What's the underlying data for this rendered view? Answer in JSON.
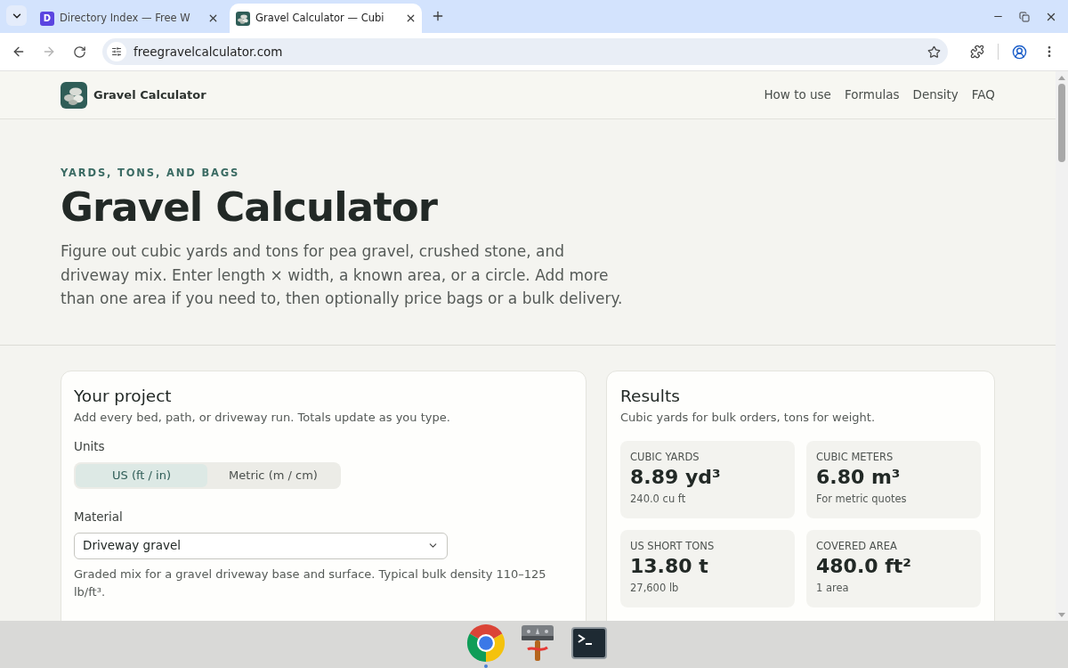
{
  "browser": {
    "tabs": [
      {
        "title": "Directory Index — Free W",
        "favicon": {
          "kind": "letter",
          "text": "D"
        },
        "selected": false
      },
      {
        "title": "Gravel Calculator — Cubi",
        "favicon": {
          "kind": "site-logo"
        },
        "selected": true
      }
    ],
    "forward_disabled": true,
    "url": "freegravelcalculator.com"
  },
  "site_header": {
    "brand": "Gravel Calculator",
    "nav": [
      "How to use",
      "Formulas",
      "Density",
      "FAQ"
    ]
  },
  "hero": {
    "eyebrow": "YARDS, TONS, AND BAGS",
    "title": "Gravel Calculator",
    "intro": "Figure out cubic yards and tons for pea gravel, crushed stone, and driveway mix. Enter length × width, a known area, or a circle. Add more than one area if you need to, then optionally price bags or a bulk delivery."
  },
  "project": {
    "title": "Your project",
    "subtitle": "Add every bed, path, or driveway run. Totals update as you type.",
    "units": {
      "label": "Units",
      "options": [
        {
          "label": "US (ft / in)",
          "selected": true
        },
        {
          "label": "Metric (m / cm)",
          "selected": false
        }
      ]
    },
    "material": {
      "label": "Material",
      "value": "Driveway gravel",
      "hint": "Graded mix for a gravel driveway base and surface. Typical bulk density 110–125 lb/ft³."
    }
  },
  "results": {
    "title": "Results",
    "subtitle": "Cubic yards for bulk orders, tons for weight.",
    "stats": [
      {
        "label": "CUBIC YARDS",
        "value": "8.89 yd³",
        "note": "240.0 cu ft"
      },
      {
        "label": "CUBIC METERS",
        "value": "6.80 m³",
        "note": "For metric quotes"
      },
      {
        "label": "US SHORT TONS",
        "value": "13.80 t",
        "note": "27,600 lb"
      },
      {
        "label": "COVERED AREA",
        "value": "480.0 ft²",
        "note": "1 area"
      }
    ]
  },
  "taskbar": {
    "apps": [
      {
        "kind": "browser",
        "running": true
      },
      {
        "kind": "tool",
        "running": false
      },
      {
        "kind": "terminal",
        "running": false
      }
    ]
  }
}
